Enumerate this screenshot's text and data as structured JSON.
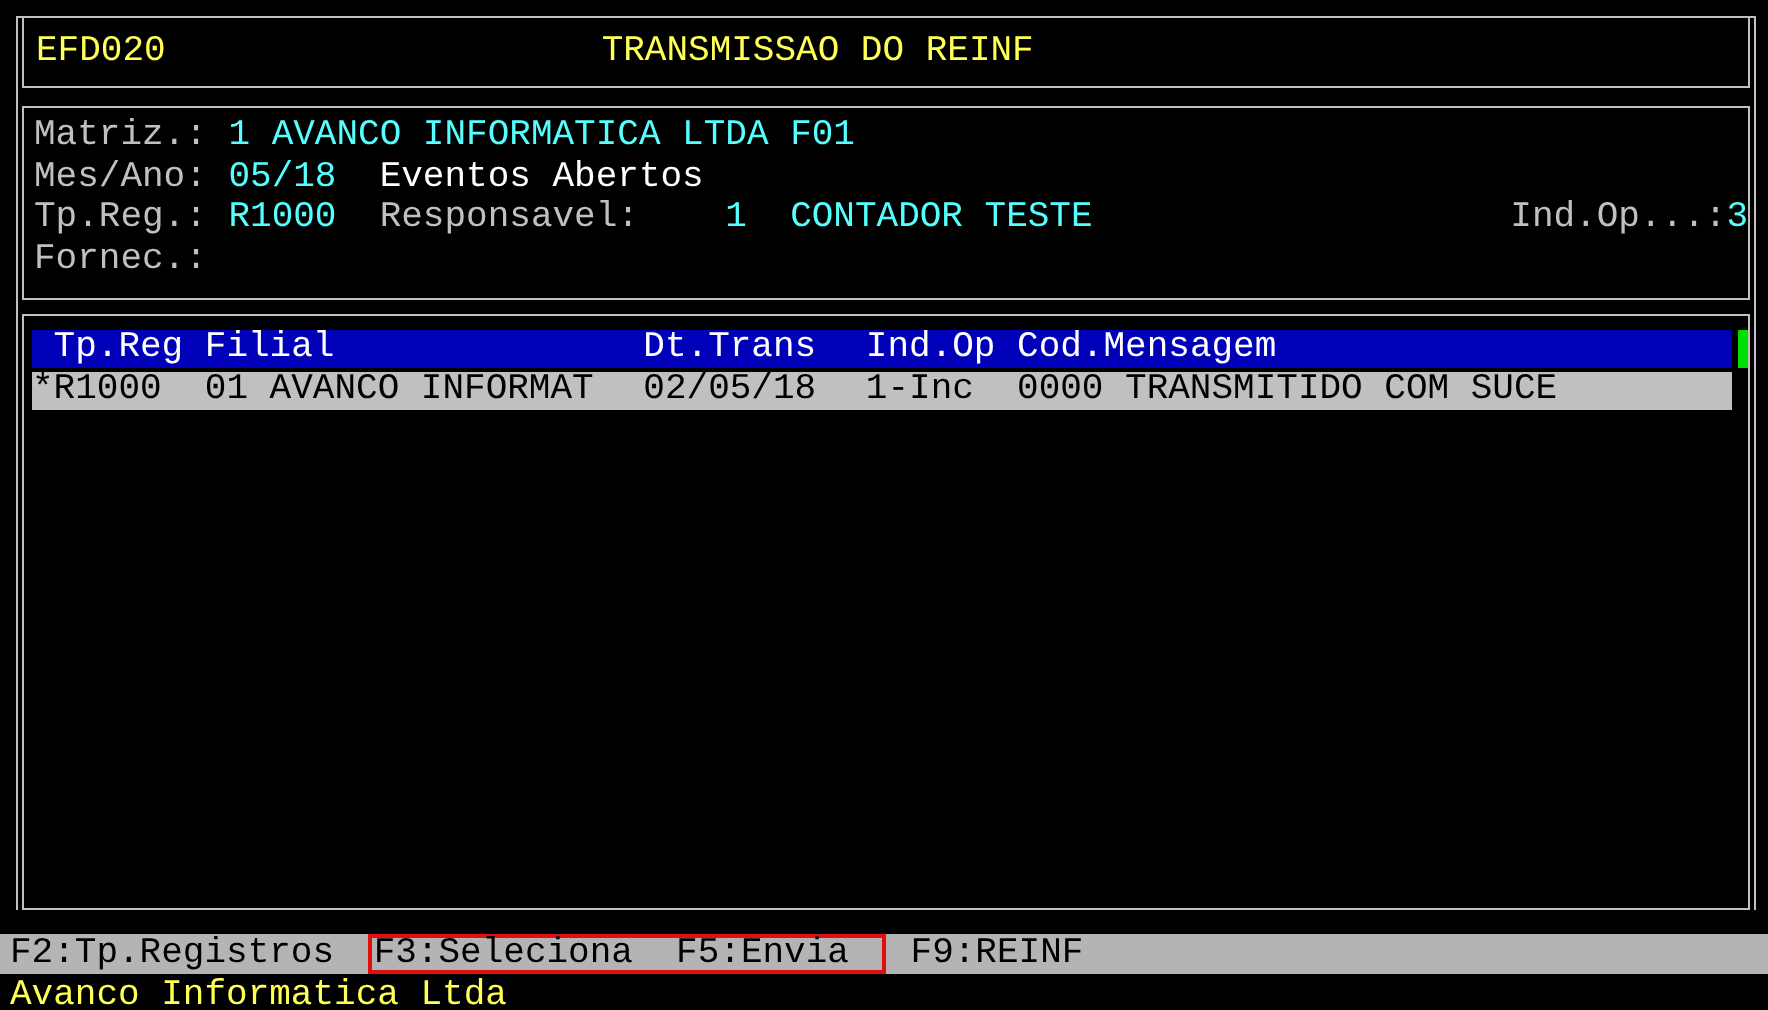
{
  "header": {
    "program": "EFD020",
    "title": "TRANSMISSAO DO REINF"
  },
  "info_lines": [
    {
      "segments": [
        {
          "kind": "label",
          "text": "Matriz.:"
        },
        {
          "kind": "value",
          "text": "1 AVANCO INFORMATICA LTDA F01"
        }
      ]
    },
    {
      "segments": [
        {
          "kind": "label",
          "text": "Mes/Ano:"
        },
        {
          "kind": "value",
          "text": "05/18"
        },
        {
          "kind": "note",
          "text": "Eventos Abertos"
        }
      ]
    },
    {
      "segments": [
        {
          "kind": "label",
          "text": "Tp.Reg.:"
        },
        {
          "kind": "value",
          "text": "R1000"
        },
        {
          "kind": "label",
          "text": "Responsavel:"
        },
        {
          "kind": "value",
          "text": "1"
        },
        {
          "kind": "value",
          "text": "CONTADOR TESTE"
        },
        {
          "kind": "right_label",
          "text": "Ind.Op...:"
        },
        {
          "kind": "value",
          "text": "3"
        }
      ]
    },
    {
      "segments": [
        {
          "kind": "label",
          "text": "Fornec.:"
        }
      ]
    }
  ],
  "table": {
    "columns": [
      "Tp.Reg",
      "Filial",
      "Dt.Trans",
      "Ind.Op",
      "Cod.Mensagem"
    ],
    "rows": [
      {
        "selected": true,
        "cells": [
          "*R1000",
          "01 AVANCO INFORMAT",
          "02/05/18",
          "1-Inc",
          "0000",
          "TRANSMITIDO COM SUCE"
        ]
      }
    ]
  },
  "function_keys": [
    {
      "label": "F2:Tp.Registros",
      "highlighted": false
    },
    {
      "label": "F3:Seleciona",
      "highlighted": true
    },
    {
      "label": "F5:Envia",
      "highlighted": true
    },
    {
      "label": "F9:REINF",
      "highlighted": false
    }
  ],
  "status_bar": "Avanco Informatica Ltda"
}
